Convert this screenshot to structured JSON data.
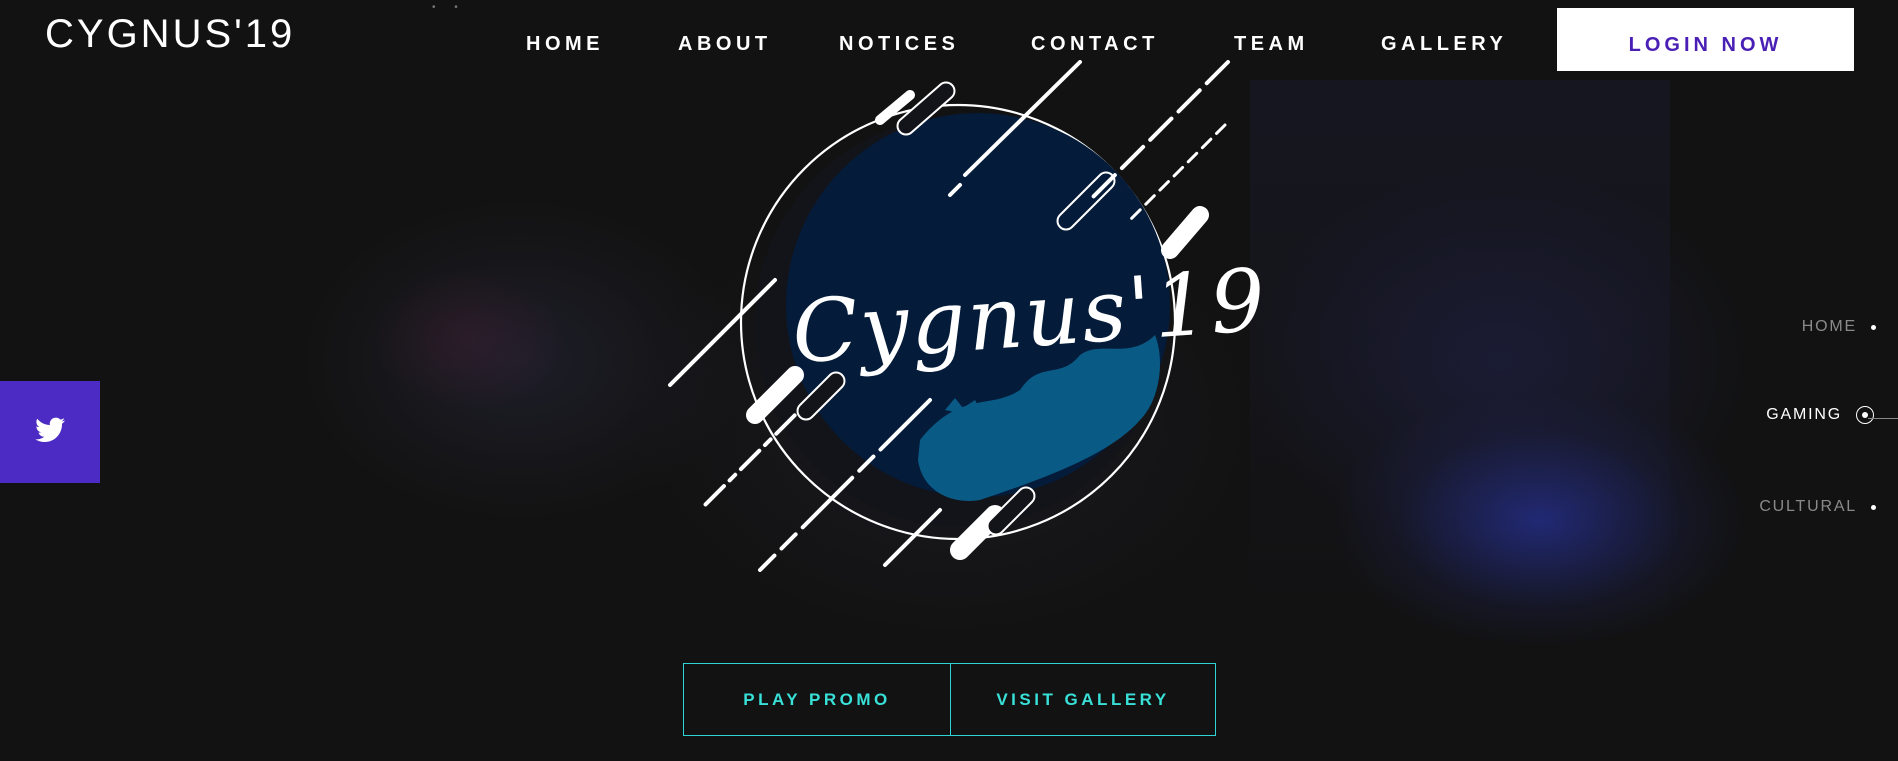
{
  "brand": {
    "title": "CYGNUS'19"
  },
  "nav": {
    "items": [
      {
        "label": "HOME"
      },
      {
        "label": "ABOUT"
      },
      {
        "label": "NOTICES"
      },
      {
        "label": "CONTACT"
      },
      {
        "label": "TEAM"
      },
      {
        "label": "GALLERY"
      }
    ],
    "login_label": "LOGIN NOW"
  },
  "social": {
    "icon": "twitter-icon"
  },
  "logo": {
    "text": "Cygnus'19"
  },
  "side_nav": {
    "items": [
      {
        "label": "HOME",
        "active": false
      },
      {
        "label": "GAMING",
        "active": true
      },
      {
        "label": "CULTURAL",
        "active": false
      }
    ]
  },
  "cta": {
    "promo_label": "PLAY PROMO",
    "gallery_label": "VISIT GALLERY"
  },
  "colors": {
    "background": "#121212",
    "accent_purple": "#4b2bc4",
    "login_text": "#4a1fb5",
    "cta_teal": "#2dd4d4",
    "logo_circle": "#041b3a",
    "logo_splash": "#0a5a86"
  }
}
